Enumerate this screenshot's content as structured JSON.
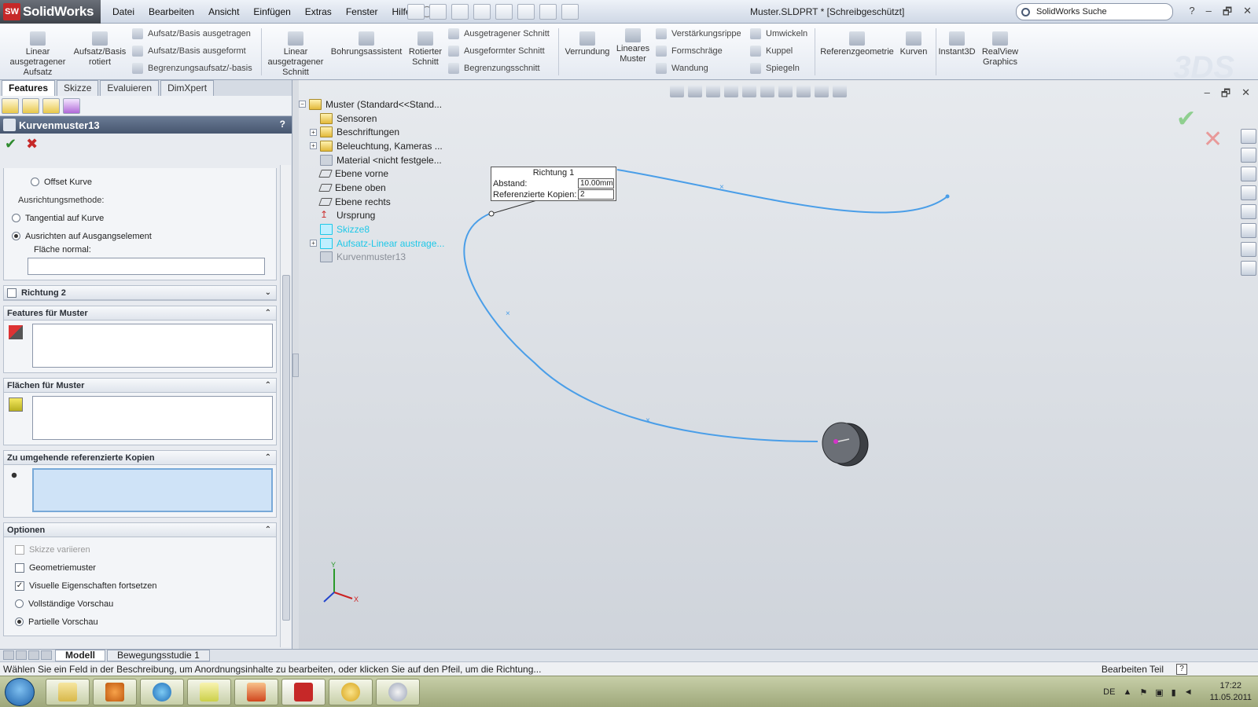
{
  "app": {
    "logo_text": "SolidWorks",
    "logo_badge": "SW",
    "doc_title": "Muster.SLDPRT * [Schreibgeschützt]",
    "search_placeholder": "SolidWorks Suche"
  },
  "menu": [
    "Datei",
    "Bearbeiten",
    "Ansicht",
    "Einfügen",
    "Extras",
    "Fenster",
    "Hilfe"
  ],
  "window_controls": [
    "?",
    "–",
    "🗗",
    "✕"
  ],
  "ribbon": {
    "big": {
      "linear_boss": "Linear ausgetragener Aufsatz",
      "revolve_boss": "Aufsatz/Basis rotiert",
      "linear_cut": "Linear ausgetragener Schnitt",
      "hole_wizard": "Bohrungsassistent",
      "revolve_cut": "Rotierter Schnitt",
      "fillet": "Verrundung",
      "linear_pattern": "Lineares Muster",
      "ref_geometry": "Referenzgeometrie",
      "curves": "Kurven",
      "instant3d": "Instant3D",
      "realview": "RealView Graphics"
    },
    "small": {
      "swept_boss": "Aufsatz/Basis ausgetragen",
      "lofted_boss": "Aufsatz/Basis ausgeformt",
      "boundary_boss": "Begrenzungsaufsatz/-basis",
      "swept_cut": "Ausgetragener Schnitt",
      "lofted_cut": "Ausgeformter Schnitt",
      "boundary_cut": "Begrenzungsschnitt",
      "rib": "Verstärkungsrippe",
      "draft": "Formschräge",
      "shell": "Wandung",
      "wrap": "Umwickeln",
      "dome": "Kuppel",
      "mirror": "Spiegeln"
    }
  },
  "tabs": [
    "Features",
    "Skizze",
    "Evaluieren",
    "DimXpert"
  ],
  "property_manager": {
    "title": "Kurvenmuster13",
    "help": "?",
    "ok": "✔",
    "cancel": "✖",
    "orientation": {
      "offset_curve": "Offset Kurve",
      "method_label": "Ausrichtungsmethode:",
      "tangent": "Tangential auf Kurve",
      "align_seed": "Ausrichten auf Ausgangselement",
      "face_normal_label": "Fläche normal:"
    },
    "direction2": "Richtung 2",
    "features_group": "Features für Muster",
    "faces_group": "Flächen für Muster",
    "skip_group": "Zu umgehende referenzierte Kopien",
    "options_group": "Optionen",
    "options": {
      "vary_sketch": "Skizze variieren",
      "geometry_pattern": "Geometriemuster",
      "propagate_visual": "Visuelle Eigenschaften fortsetzen",
      "full_preview": "Vollständige Vorschau",
      "partial_preview": "Partielle Vorschau"
    }
  },
  "tree": [
    "Muster  (Standard<<Stand...",
    "Sensoren",
    "Beschriftungen",
    "Beleuchtung, Kameras ...",
    "Material <nicht festgele...",
    "Ebene vorne",
    "Ebene oben",
    "Ebene rechts",
    "Ursprung",
    "Skizze8",
    "Aufsatz-Linear austrage...",
    "Kurvenmuster13"
  ],
  "callout": {
    "title": "Richtung 1",
    "distance_label": "Abstand:",
    "distance_value": "10.00mm",
    "copies_label": "Referenzierte Kopien:",
    "copies_value": "2"
  },
  "triad": {
    "x": "X",
    "y": "Y"
  },
  "bottom_tabs": [
    "Modell",
    "Bewegungsstudie 1"
  ],
  "status": {
    "message": "Wählen Sie ein Feld in der Beschreibung, um Anordnungsinhalte zu bearbeiten, oder klicken Sie auf den Pfeil, um die Richtung...",
    "mode": "Bearbeiten Teil",
    "help": "?"
  },
  "taskbar": {
    "language": "DE",
    "time": "17:22",
    "date": "11.05.2011"
  },
  "colors": {
    "curve": "#4a9ee8",
    "accent": "#47566f"
  }
}
